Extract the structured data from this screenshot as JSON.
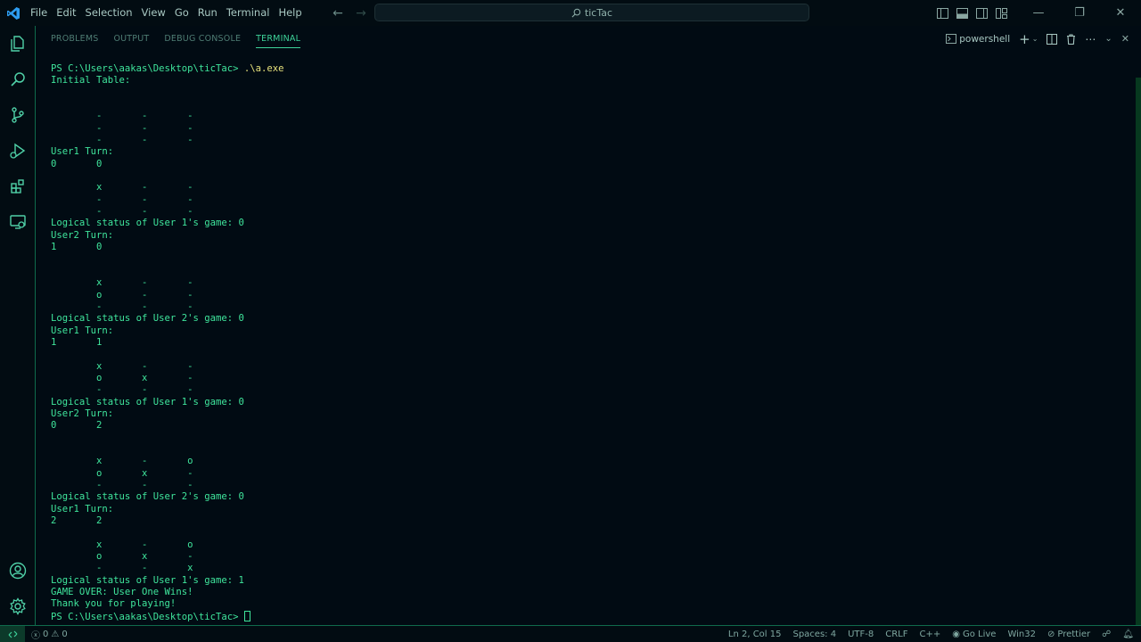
{
  "titlebar": {
    "menu": [
      "File",
      "Edit",
      "Selection",
      "View",
      "Go",
      "Run",
      "Terminal",
      "Help"
    ],
    "search_label": "ticTac",
    "window_controls": {
      "minimize": "—",
      "restore": "❐",
      "close": "✕"
    }
  },
  "panel": {
    "tabs": [
      "PROBLEMS",
      "OUTPUT",
      "DEBUG CONSOLE",
      "TERMINAL"
    ],
    "active_tab": "TERMINAL",
    "shell_label": "powershell"
  },
  "terminal": {
    "prompt": "PS C:\\Users\\aakas\\Desktop\\ticTac>",
    "command": ".\\a.exe",
    "lines": [
      "Initial Table:",
      "",
      "",
      "        -       -       -",
      "        -       -       -",
      "        -       -       -",
      "User1 Turn:",
      "0       0",
      "",
      "        x       -       -",
      "        -       -       -",
      "        -       -       -",
      "Logical status of User 1's game: 0",
      "User2 Turn:",
      "1       0",
      "",
      "",
      "        x       -       -",
      "        o       -       -",
      "        -       -       -",
      "Logical status of User 2's game: 0",
      "User1 Turn:",
      "1       1",
      "",
      "        x       -       -",
      "        o       x       -",
      "        -       -       -",
      "Logical status of User 1's game: 0",
      "User2 Turn:",
      "0       2",
      "",
      "",
      "        x       -       o",
      "        o       x       -",
      "        -       -       -",
      "Logical status of User 2's game: 0",
      "User1 Turn:",
      "2       2",
      "",
      "        x       -       o",
      "        o       x       -",
      "        -       -       x",
      "Logical status of User 1's game: 1",
      "GAME OVER: User One Wins!",
      "Thank you for playing!"
    ]
  },
  "statusbar": {
    "errors": "0",
    "warnings": "0",
    "position": "Ln 2, Col 15",
    "spaces": "Spaces: 4",
    "encoding": "UTF-8",
    "eol": "CRLF",
    "language": "C++",
    "go_live": "Go Live",
    "platform": "Win32",
    "prettier": "Prettier"
  },
  "colors": {
    "terminal_text": "#3fe59c",
    "command_text": "#e6e27c",
    "accent": "#3ed39a",
    "background": "#010b13"
  }
}
